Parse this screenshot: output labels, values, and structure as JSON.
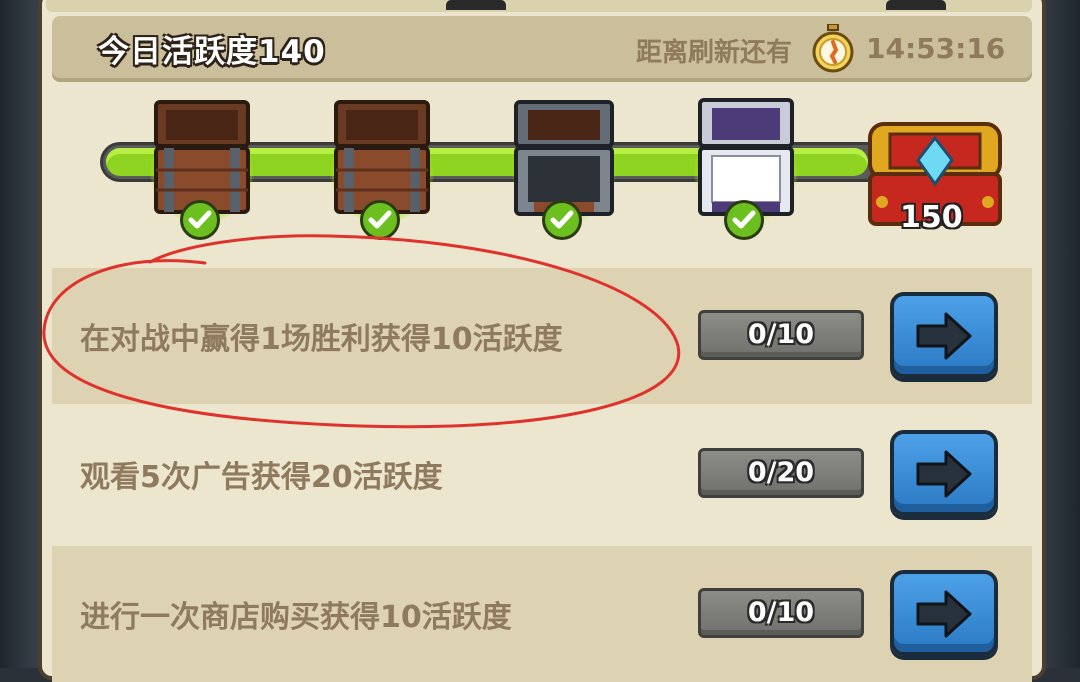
{
  "header": {
    "title": "今日活跃度140",
    "refresh_label": "距离刷新还有",
    "timer": "14:53:16"
  },
  "progress": {
    "fill_fraction": 0.92,
    "chests": [
      {
        "type": "wooden",
        "claimed": true
      },
      {
        "type": "wooden",
        "claimed": true
      },
      {
        "type": "iron",
        "claimed": true
      },
      {
        "type": "silver",
        "claimed": true
      }
    ],
    "final_chest_value": "150"
  },
  "tasks": [
    {
      "text": "在对战中赢得1场胜利获得10活跃度",
      "progress": "0/10"
    },
    {
      "text": "观看5次广告获得20活跃度",
      "progress": "0/20"
    },
    {
      "text": "进行一次商店购买获得10活跃度",
      "progress": "0/10"
    }
  ],
  "icons": {
    "stopwatch": "stopwatch-icon",
    "check": "check-icon",
    "arrow": "arrow-right-icon"
  },
  "colors": {
    "bar_fill": "#8fd321",
    "button_blue": "#3a8ad6",
    "annotation_red": "#e0322d",
    "text_brown": "#8f7a5d"
  }
}
